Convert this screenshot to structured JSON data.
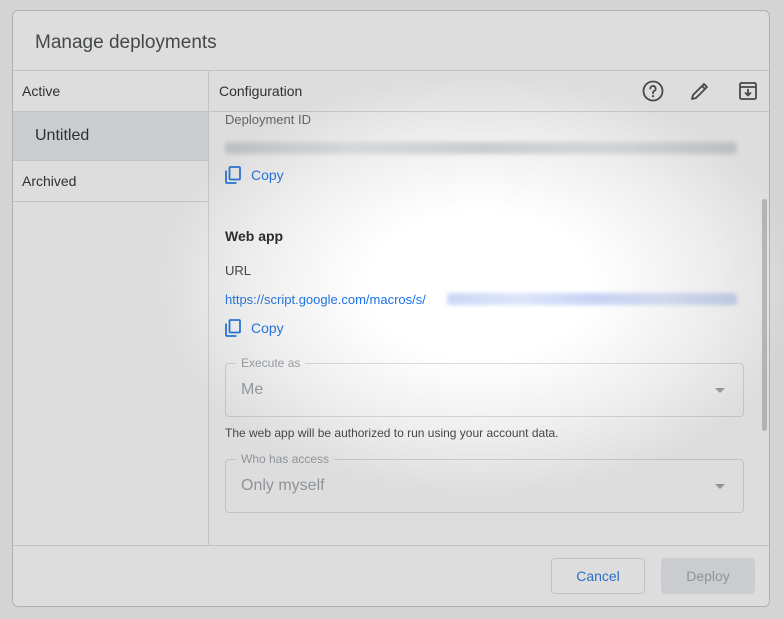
{
  "dialog": {
    "title": "Manage deployments"
  },
  "sidebar": {
    "active_label": "Active",
    "items": [
      {
        "label": "Untitled",
        "selected": true
      }
    ],
    "archived_label": "Archived"
  },
  "main": {
    "header_label": "Configuration",
    "icons": [
      "help-icon",
      "edit-pencil-icon",
      "archive-icon"
    ],
    "deployment_id_label": "Deployment ID",
    "copy_label": "Copy",
    "web_app_title": "Web app",
    "url_label": "URL",
    "url_visible": "https://script.google.com/macros/s/",
    "execute_as": {
      "legend": "Execute as",
      "value": "Me"
    },
    "helper_text": "The web app will be authorized to run using your account data.",
    "who_has_access": {
      "legend": "Who has access",
      "value": "Only myself"
    }
  },
  "footer": {
    "cancel_label": "Cancel",
    "deploy_label": "Deploy"
  },
  "colors": {
    "accent": "#1a73e8",
    "selected_bg": "#e8eaed",
    "border": "#dadce0"
  }
}
